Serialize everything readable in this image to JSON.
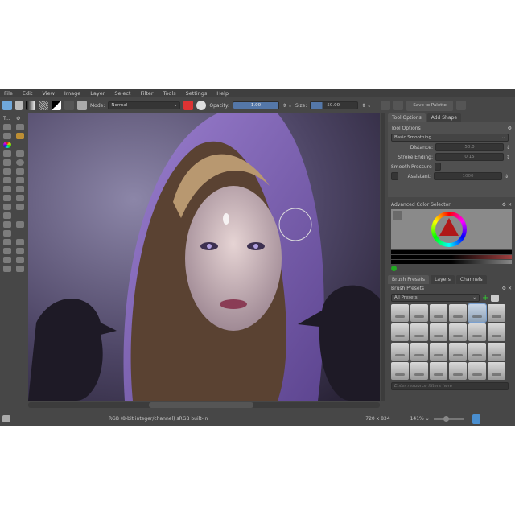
{
  "menu": [
    "File",
    "Edit",
    "View",
    "Image",
    "Layer",
    "Select",
    "Filter",
    "Tools",
    "Settings",
    "Help"
  ],
  "toolbar": {
    "mode_label": "Mode:",
    "blend_mode": "Normal",
    "opacity_label": "Opacity:",
    "opacity_value": "1.00",
    "size_label": "Size:",
    "size_value": "50.00",
    "save_palette": "Save to Palette",
    "opacity_fraction": 1.0,
    "size_fraction": 0.25
  },
  "toolbox_header": "T...",
  "dock": {
    "tabs": [
      "Tool Options",
      "Add Shape"
    ],
    "tool_options_title": "Tool Options",
    "smoothing": "Basic Smoothing",
    "distance_label": "Distance:",
    "distance_value": "50.0",
    "stroke_ending_label": "Stroke Ending:",
    "stroke_ending_value": "0.15",
    "smooth_pressure_label": "Smooth Pressure",
    "assistant_label": "Assistant:",
    "assistant_value": "1000",
    "color_selector_title": "Advanced Color Selector",
    "bottom_tabs": [
      "Brush Presets",
      "Layers",
      "Channels"
    ],
    "brush_presets_title": "Brush Presets",
    "preset_filter": "All Presets",
    "filter_placeholder": "Enter resource filters here"
  },
  "status": {
    "color_space": "RGB (8-bit integer/channel)  sRGB built-in",
    "dimensions": "720 x 834",
    "zoom": "141%"
  },
  "accent": "#5477a8"
}
